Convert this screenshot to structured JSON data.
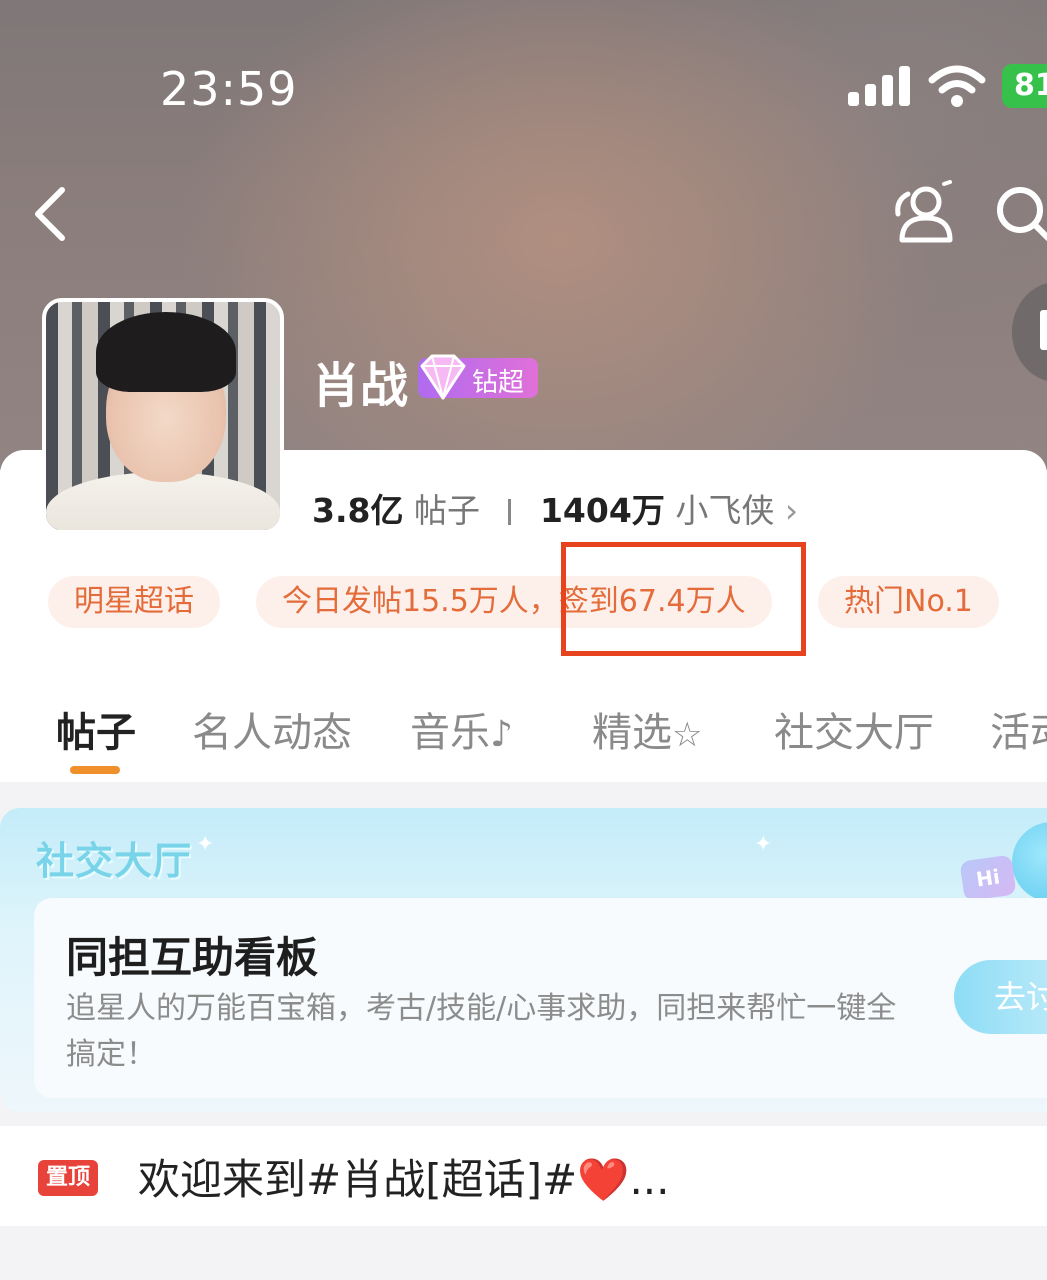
{
  "status_bar": {
    "time": "23:59",
    "battery": "81"
  },
  "topic": {
    "name": "肖战",
    "badge_label": "钻超",
    "posts_count": "3.8亿",
    "posts_label": "帖子",
    "fans_count": "1404万",
    "fans_label": "小飞侠",
    "chevron": "›"
  },
  "pills": [
    {
      "label": "明星超话"
    },
    {
      "label": "今日发帖15.5万人，签到67.4万人"
    },
    {
      "label": "热门No.1"
    }
  ],
  "tabs": [
    {
      "label": "帖子",
      "active": true
    },
    {
      "label": "名人动态"
    },
    {
      "label": "音乐"
    },
    {
      "label": "精选"
    },
    {
      "label": "社交大厅"
    },
    {
      "label": "活动"
    }
  ],
  "social_hall": {
    "title": "社交大厅",
    "hi": "Hi",
    "board_title": "同担互助看板",
    "board_desc": "追星人的万能百宝箱，考古/技能/心事求助，同担来帮忙一键全搞定！",
    "go_button": "去讨"
  },
  "pinned_post": {
    "tag": "置顶",
    "text": "欢迎来到#肖战[超话]#",
    "emoji": "❤️",
    "ellipsis": "..."
  },
  "colors": {
    "accent_orange": "#f0902a",
    "pill_text": "#e46b3a",
    "highlight_border": "#e8431f",
    "badge_purple": "#b06bf0",
    "pin_red": "#e8433a"
  },
  "icons": [
    "back-icon",
    "people-icon",
    "search-icon",
    "signal-icon",
    "wifi-icon",
    "diamond-icon",
    "music-note-icon",
    "star-icon"
  ]
}
